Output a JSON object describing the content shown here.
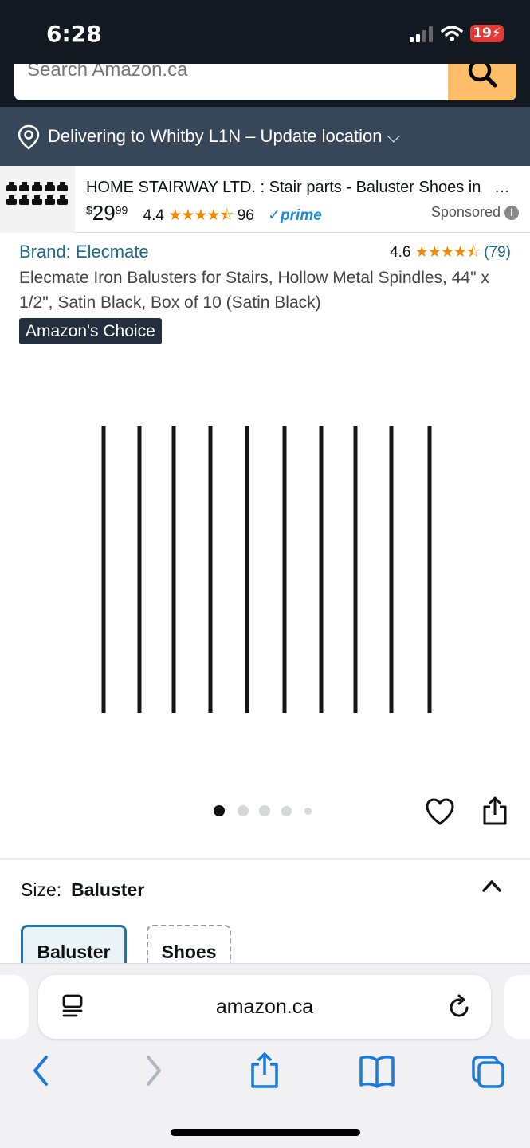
{
  "status": {
    "time": "6:28",
    "battery": "19"
  },
  "search": {
    "placeholder": "Search Amazon.ca"
  },
  "location": {
    "text": "Delivering to Whitby L1N – Update location ⌵"
  },
  "sponsored": {
    "title": "HOME STAIRWAY LTD. : Stair parts - Baluster Shoes in",
    "ellipsis": "…",
    "price_symbol": "$",
    "price_whole": "29",
    "price_fraction": "99",
    "rating": "4.4",
    "stars": "★★★★⯪",
    "reviews": "96",
    "prime": "✓prime",
    "label": "Sponsored"
  },
  "product": {
    "brand": "Brand: Elecmate",
    "rating": "4.6",
    "stars": "★★★★⯪",
    "rating_count": "(79)",
    "title": "Elecmate Iron Balusters for Stairs, Hollow Metal Spindles, 44\" x 1/2\", Satin Black, Box of 10 (Satin Black)",
    "badge": "Amazon's Choice",
    "image_count": 5,
    "image_index": 1
  },
  "size": {
    "label": "Size:",
    "value": "Baluster",
    "options": [
      "Baluster",
      "Shoes"
    ]
  },
  "browser": {
    "url": "amazon.ca"
  },
  "colors": {
    "accent": "#febd69",
    "header": "#131921",
    "location_bar": "#37475a",
    "link": "#1b6a8a",
    "star": "#f08804",
    "safari_blue": "#1a7ae0"
  }
}
